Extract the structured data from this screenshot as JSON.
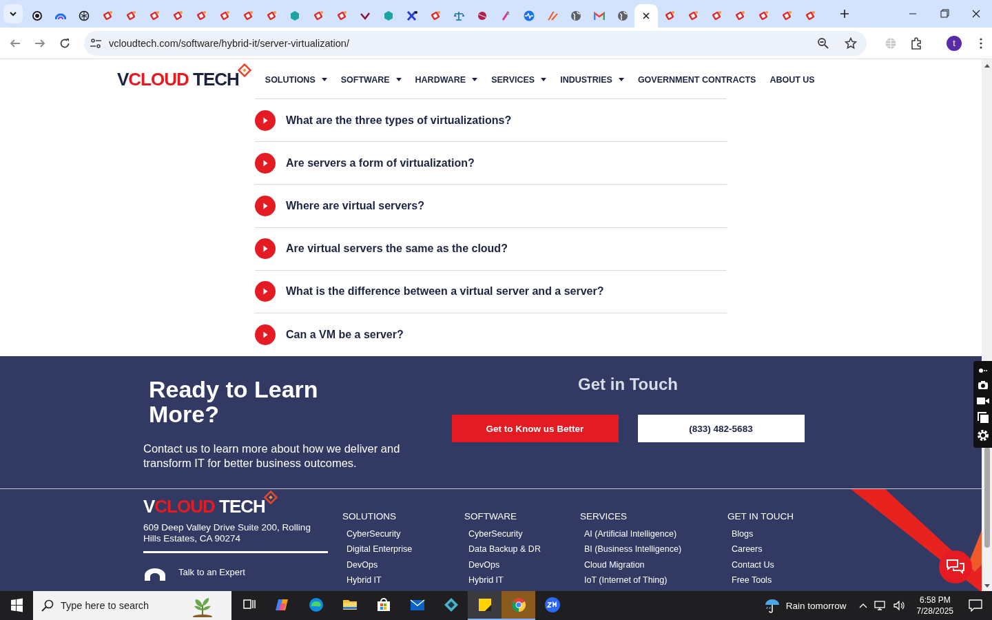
{
  "browser": {
    "tabs": [
      {
        "kind": "ring",
        "selected": false
      },
      {
        "kind": "arc",
        "selected": false
      },
      {
        "kind": "swirl",
        "selected": false
      },
      {
        "kind": "tag",
        "selected": false
      },
      {
        "kind": "tag",
        "selected": false
      },
      {
        "kind": "tag",
        "selected": false
      },
      {
        "kind": "tag",
        "selected": false
      },
      {
        "kind": "tag",
        "selected": false
      },
      {
        "kind": "tag",
        "selected": false
      },
      {
        "kind": "tag",
        "selected": false
      },
      {
        "kind": "tag",
        "selected": false
      },
      {
        "kind": "hex",
        "selected": false
      },
      {
        "kind": "tag",
        "selected": false
      },
      {
        "kind": "tag",
        "selected": false
      },
      {
        "kind": "check",
        "selected": false
      },
      {
        "kind": "hex",
        "selected": false
      },
      {
        "kind": "cross",
        "selected": false
      },
      {
        "kind": "tag",
        "selected": false
      },
      {
        "kind": "scale",
        "selected": false
      },
      {
        "kind": "ball",
        "selected": false
      },
      {
        "kind": "pen",
        "selected": false
      },
      {
        "kind": "pulse",
        "selected": false
      },
      {
        "kind": "slash",
        "selected": false
      },
      {
        "kind": "globe",
        "selected": false
      },
      {
        "kind": "mail",
        "selected": false
      },
      {
        "kind": "globe",
        "selected": false
      },
      {
        "kind": "blank",
        "selected": true
      },
      {
        "kind": "tag",
        "selected": false
      },
      {
        "kind": "tag",
        "selected": false
      },
      {
        "kind": "tag",
        "selected": false
      },
      {
        "kind": "tag",
        "selected": false
      },
      {
        "kind": "tag",
        "selected": false
      },
      {
        "kind": "tag",
        "selected": false
      },
      {
        "kind": "tag",
        "selected": false
      }
    ],
    "url": "vcloudtech.com/software/hybrid-it/server-virtualization/",
    "profile": "t"
  },
  "header": {
    "logo": {
      "v": "V",
      "cloud": "CLOUD",
      "tech": "TECH"
    },
    "menu": [
      {
        "label": "SOLUTIONS",
        "dropdown": true
      },
      {
        "label": "SOFTWARE",
        "dropdown": true
      },
      {
        "label": "HARDWARE",
        "dropdown": true
      },
      {
        "label": "SERVICES",
        "dropdown": true
      },
      {
        "label": "INDUSTRIES",
        "dropdown": true
      },
      {
        "label": "GOVERNMENT CONTRACTS",
        "dropdown": false
      },
      {
        "label": "ABOUT US",
        "dropdown": false
      }
    ]
  },
  "faq": [
    {
      "question": "What are the three types of virtualizations?",
      "expanded": false
    },
    {
      "question": "Are servers a form of virtualization?",
      "expanded": false
    },
    {
      "question": "Where are virtual servers?",
      "expanded": false
    },
    {
      "question": "Are virtual servers the same as the cloud?",
      "expanded": false
    },
    {
      "question": "What is the difference between a virtual server and a server?",
      "expanded": false
    },
    {
      "question": "Can a VM be a server?",
      "expanded": false
    }
  ],
  "cta": {
    "heading": "Ready to Learn More?",
    "text": "Contact us to learn more about how we deliver and transform IT for better business outcomes.",
    "side_heading": "Get in Touch",
    "buttons": [
      {
        "label": "Get to Know us Better",
        "kind": "primary"
      },
      {
        "label": "(833) 482-5683",
        "kind": "outline"
      }
    ]
  },
  "footer": {
    "logo": {
      "v": "V",
      "cloud": "CLOUD",
      "tech": "TECH"
    },
    "address": "609 Deep Valley Drive Suite 200, Rolling Hills Estates, CA 90274",
    "contact_label": "Talk to an Expert",
    "columns": [
      {
        "heading": "SOLUTIONS",
        "links": [
          "CyberSecurity",
          "Digital Enterprise",
          "DevOps",
          "Hybrid IT"
        ]
      },
      {
        "heading": "SOFTWARE",
        "links": [
          "CyberSecurity",
          "Data Backup & DR",
          "DevOps",
          "Hybrid IT"
        ]
      },
      {
        "heading": "SERVICES",
        "links": [
          "AI (Artificial Intelligence)",
          "BI (Business Intelligence)",
          "Cloud Migration",
          "IoT (Internet of Thing)"
        ]
      },
      {
        "heading": "GET IN TOUCH",
        "links": [
          "Blogs",
          "Careers",
          "Contact Us",
          "Free Tools"
        ]
      }
    ]
  },
  "taskbar": {
    "search_placeholder": "Type here to search",
    "apps": [
      {
        "kind": "taskview",
        "active": false
      },
      {
        "kind": "copilot",
        "active": false
      },
      {
        "kind": "edge",
        "active": false
      },
      {
        "kind": "folder",
        "active": false
      },
      {
        "kind": "store",
        "active": false
      },
      {
        "kind": "mail",
        "active": false
      },
      {
        "kind": "diamond",
        "active": false
      },
      {
        "kind": "notes",
        "active": true
      },
      {
        "kind": "chrome",
        "active": true
      },
      {
        "kind": "zoom",
        "active": false
      }
    ],
    "weather": "Rain tomorrow",
    "time": "6:58 PM",
    "date": "7/28/2025"
  }
}
